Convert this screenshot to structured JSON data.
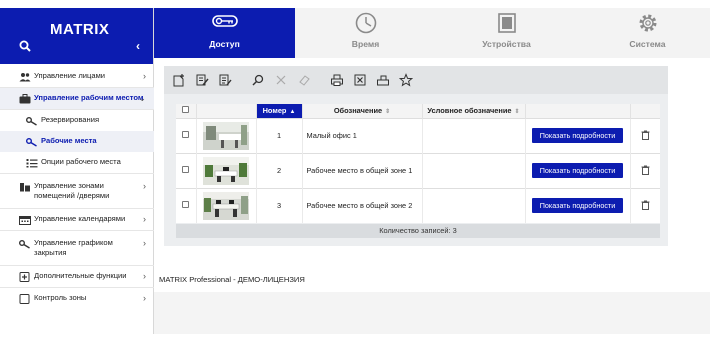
{
  "brand": {
    "title": "MATRIX"
  },
  "tabs": [
    {
      "label": "Доступ",
      "icon": "key-icon",
      "active": true
    },
    {
      "label": "Время",
      "icon": "clock-icon",
      "active": false
    },
    {
      "label": "Устройства",
      "icon": "device-icon",
      "active": false
    },
    {
      "label": "Система",
      "icon": "gear-icon",
      "active": false
    }
  ],
  "sidebar": {
    "items": [
      {
        "label": "Управление лицами"
      },
      {
        "label": "Управление рабочим местом"
      },
      {
        "label": "Резервирования"
      },
      {
        "label": "Рабочие места"
      },
      {
        "label": "Опции рабочего места"
      },
      {
        "label": "Управление зонами помещений /дверями"
      },
      {
        "label": "Управление календарями"
      },
      {
        "label": "Управление графиком закрытия"
      },
      {
        "label": "Дополнительные функции"
      },
      {
        "label": "Контроль зоны"
      }
    ]
  },
  "table": {
    "headers": {
      "number": "Номер",
      "name": "Обозначение",
      "short_name": "Условное обозначение"
    },
    "rows": [
      {
        "number": "1",
        "name": "Малый офис 1",
        "button": "Показать подробности"
      },
      {
        "number": "2",
        "name": "Рабочее место в общей зоне 1",
        "button": "Показать подробности"
      },
      {
        "number": "3",
        "name": "Рабочее место в общей зоне 2",
        "button": "Показать подробности"
      }
    ],
    "count_text": "Количество записей: 3"
  },
  "license_text": "MATRIX Professional - ДЕМО-ЛИЦЕНЗИЯ",
  "colors": {
    "accent": "#0c1cb0",
    "toolbar": "#e2e4e6",
    "content_bg": "#eceef0"
  }
}
